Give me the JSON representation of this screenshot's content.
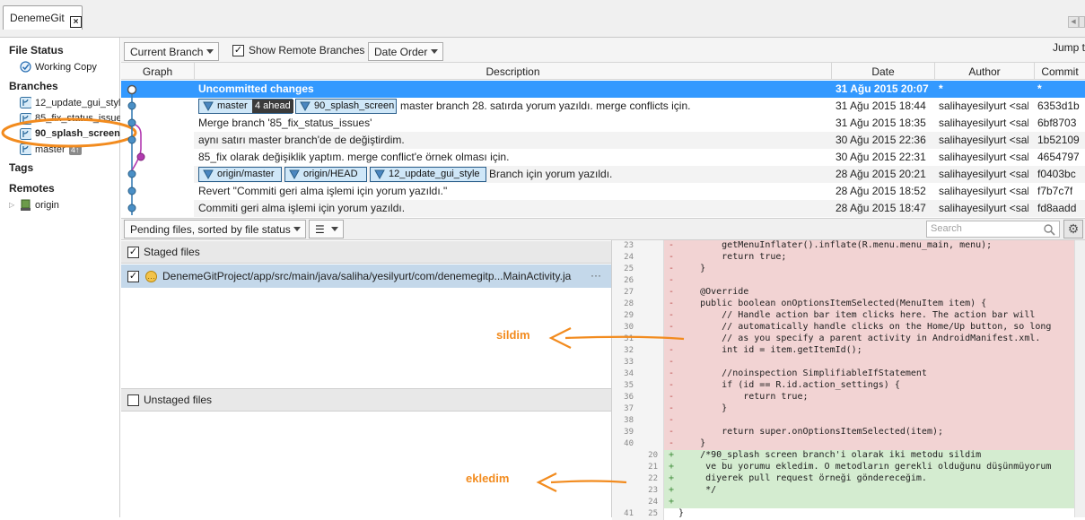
{
  "tab": {
    "title": "DenemeGit"
  },
  "sidebar": {
    "file_status": "File Status",
    "working_copy": "Working Copy",
    "branches": "Branches",
    "branch_items": [
      "12_update_gui_style",
      "85_fix_status_issues",
      "90_splash_screen",
      "master"
    ],
    "master_badge": "4↑",
    "tags": "Tags",
    "remotes": "Remotes",
    "remote_items": [
      "origin"
    ]
  },
  "toolbar": {
    "branch_filter": "Current Branch",
    "show_remote": "Show Remote Branches",
    "order": "Date Order",
    "jump_to": "Jump t"
  },
  "log_columns": [
    "Graph",
    "Description",
    "Date",
    "Author",
    "Commit"
  ],
  "commits": [
    {
      "description": "Uncommitted changes",
      "date": "31 Ağu 2015 20:07",
      "author": "*",
      "commit": "*"
    },
    {
      "description": "master branch 28. satırda yorum yazıldı. merge conflicts için.",
      "date": "31 Ağu 2015 18:44",
      "author": "salihayesilyurt <sal",
      "commit": "6353d1b",
      "tags": [
        "master",
        "90_splash_screen"
      ],
      "ahead": "4 ahead"
    },
    {
      "description": "Merge branch '85_fix_status_issues'",
      "date": "31 Ağu 2015 18:35",
      "author": "salihayesilyurt <sal",
      "commit": "6bf8703"
    },
    {
      "description": "aynı satırı master branch'de de değiştirdim.",
      "date": "30 Ağu 2015 22:36",
      "author": "salihayesilyurt <sal",
      "commit": "1b52109"
    },
    {
      "description": "85_fix olarak değişiklik yaptım. merge conflict'e örnek olması için.",
      "date": "30 Ağu 2015 22:31",
      "author": "salihayesilyurt <sal",
      "commit": "4654797"
    },
    {
      "description": "Branch için yorum yazıldı.",
      "date": "28 Ağu 2015 20:21",
      "author": "salihayesilyurt <sal",
      "commit": "f0403bc",
      "tags": [
        "origin/master",
        "origin/HEAD",
        "12_update_gui_style"
      ]
    },
    {
      "description": "Revert \"Commiti geri alma işlemi için yorum yazıldı.\"",
      "date": "28 Ağu 2015 18:52",
      "author": "salihayesilyurt <sal",
      "commit": "f7b7c7f"
    },
    {
      "description": "Commiti geri alma işlemi için yorum yazıldı.",
      "date": "28 Ağu 2015 18:47",
      "author": "salihayesilyurt <sal",
      "commit": "fd8aadd"
    }
  ],
  "pending": {
    "sort_label": "Pending files, sorted by file status",
    "search_placeholder": "Search"
  },
  "staged": {
    "title": "Staged files",
    "file": "DenemeGitProject/app/src/main/java/saliha/yesilyurt/com/denemegitp...MainActivity.ja",
    "more": "···"
  },
  "unstaged": {
    "title": "Unstaged files"
  },
  "annotations": {
    "deleted": "sildim",
    "added": "ekledim"
  },
  "diff_lines": [
    {
      "old": "23",
      "new": "",
      "sign": "-",
      "code": "        getMenuInflater().inflate(R.menu.menu_main, menu);",
      "type": "del"
    },
    {
      "old": "24",
      "new": "",
      "sign": "-",
      "code": "        return true;",
      "type": "del"
    },
    {
      "old": "25",
      "new": "",
      "sign": "-",
      "code": "    }",
      "type": "del"
    },
    {
      "old": "26",
      "new": "",
      "sign": "-",
      "code": "",
      "type": "del"
    },
    {
      "old": "27",
      "new": "",
      "sign": "-",
      "code": "    @Override",
      "type": "del"
    },
    {
      "old": "28",
      "new": "",
      "sign": "-",
      "code": "    public boolean onOptionsItemSelected(MenuItem item) {",
      "type": "del"
    },
    {
      "old": "29",
      "new": "",
      "sign": "-",
      "code": "        // Handle action bar item clicks here. The action bar will",
      "type": "del"
    },
    {
      "old": "30",
      "new": "",
      "sign": "-",
      "code": "        // automatically handle clicks on the Home/Up button, so long",
      "type": "del"
    },
    {
      "old": "31",
      "new": "",
      "sign": "-",
      "code": "        // as you specify a parent activity in AndroidManifest.xml.",
      "type": "del"
    },
    {
      "old": "32",
      "new": "",
      "sign": "-",
      "code": "        int id = item.getItemId();",
      "type": "del"
    },
    {
      "old": "33",
      "new": "",
      "sign": "-",
      "code": "",
      "type": "del"
    },
    {
      "old": "34",
      "new": "",
      "sign": "-",
      "code": "        //noinspection SimplifiableIfStatement",
      "type": "del"
    },
    {
      "old": "35",
      "new": "",
      "sign": "-",
      "code": "        if (id == R.id.action_settings) {",
      "type": "del"
    },
    {
      "old": "36",
      "new": "",
      "sign": "-",
      "code": "            return true;",
      "type": "del"
    },
    {
      "old": "37",
      "new": "",
      "sign": "-",
      "code": "        }",
      "type": "del"
    },
    {
      "old": "38",
      "new": "",
      "sign": "-",
      "code": "",
      "type": "del"
    },
    {
      "old": "39",
      "new": "",
      "sign": "-",
      "code": "        return super.onOptionsItemSelected(item);",
      "type": "del"
    },
    {
      "old": "40",
      "new": "",
      "sign": "-",
      "code": "    }",
      "type": "del"
    },
    {
      "old": "",
      "new": "20",
      "sign": "+",
      "code": "    /*90_splash screen branch'i olarak iki metodu sildim",
      "type": "add"
    },
    {
      "old": "",
      "new": "21",
      "sign": "+",
      "code": "     ve bu yorumu ekledim. O metodların gerekli olduğunu düşünmüyorum",
      "type": "add"
    },
    {
      "old": "",
      "new": "22",
      "sign": "+",
      "code": "     diyerek pull request örneği göndereceğim.",
      "type": "add"
    },
    {
      "old": "",
      "new": "23",
      "sign": "+",
      "code": "     */",
      "type": "add"
    },
    {
      "old": "",
      "new": "24",
      "sign": "+",
      "code": "",
      "type": "add"
    },
    {
      "old": "41",
      "new": "25",
      "sign": "",
      "code": "}",
      "type": "ctx"
    }
  ],
  "colors": {
    "accent": "#3399ff",
    "highlight_ring": "#f28b1e",
    "deleted_bg": "#f2d3d3",
    "added_bg": "#d4ecd0",
    "annotation": "#f28b1e",
    "branch_line": "#3b7fb6",
    "merge_line": "#b23ab0"
  }
}
